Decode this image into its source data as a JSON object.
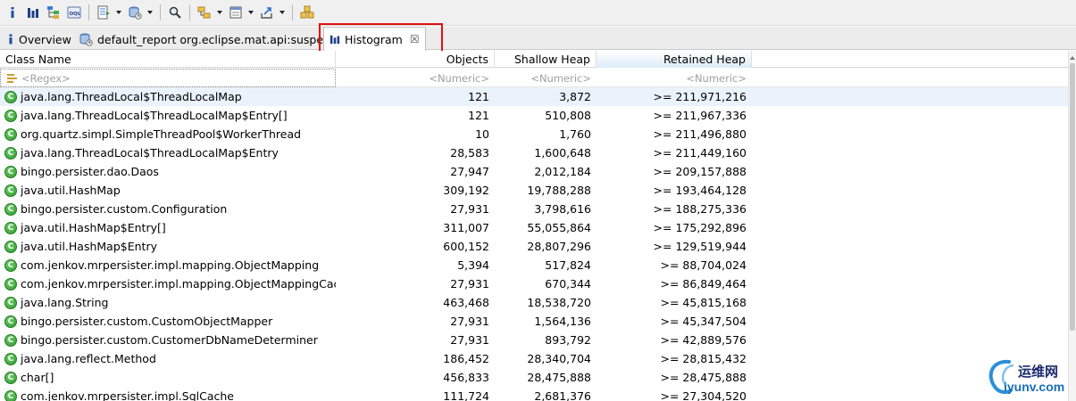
{
  "toolbar": {
    "buttons": [
      "info-icon",
      "histogram-icon",
      "dominator-tree-icon",
      "oql-icon",
      "query-browser-icon",
      "heap-dump-overview-icon",
      "search-icon",
      "group-by-icon",
      "calculate-retained-size-icon",
      "export-icon",
      "find-object-icon"
    ]
  },
  "tabs": {
    "overview": "Overview",
    "report": "default_report  org.eclipse.mat.api:suspects",
    "histogram": "Histogram",
    "close_glyph": "☒"
  },
  "table": {
    "headers": {
      "class_name": "Class Name",
      "objects": "Objects",
      "shallow_heap": "Shallow Heap",
      "retained_heap": "Retained Heap"
    },
    "filters": {
      "class_name": "<Regex>",
      "objects": "<Numeric>",
      "shallow_heap": "<Numeric>",
      "retained_heap": "<Numeric>"
    },
    "rows": [
      {
        "class_name": "java.lang.ThreadLocal$ThreadLocalMap",
        "objects": "121",
        "shallow": "3,872",
        "retained": ">= 211,971,216"
      },
      {
        "class_name": "java.lang.ThreadLocal$ThreadLocalMap$Entry[]",
        "objects": "121",
        "shallow": "510,808",
        "retained": ">= 211,967,336"
      },
      {
        "class_name": "org.quartz.simpl.SimpleThreadPool$WorkerThread",
        "objects": "10",
        "shallow": "1,760",
        "retained": ">= 211,496,880"
      },
      {
        "class_name": "java.lang.ThreadLocal$ThreadLocalMap$Entry",
        "objects": "28,583",
        "shallow": "1,600,648",
        "retained": ">= 211,449,160"
      },
      {
        "class_name": "bingo.persister.dao.Daos",
        "objects": "27,947",
        "shallow": "2,012,184",
        "retained": ">= 209,157,888"
      },
      {
        "class_name": "java.util.HashMap",
        "objects": "309,192",
        "shallow": "19,788,288",
        "retained": ">= 193,464,128"
      },
      {
        "class_name": "bingo.persister.custom.Configuration",
        "objects": "27,931",
        "shallow": "3,798,616",
        "retained": ">= 188,275,336"
      },
      {
        "class_name": "java.util.HashMap$Entry[]",
        "objects": "311,007",
        "shallow": "55,055,864",
        "retained": ">= 175,292,896"
      },
      {
        "class_name": "java.util.HashMap$Entry",
        "objects": "600,152",
        "shallow": "28,807,296",
        "retained": ">= 129,519,944"
      },
      {
        "class_name": "com.jenkov.mrpersister.impl.mapping.ObjectMapping",
        "objects": "5,394",
        "shallow": "517,824",
        "retained": ">= 88,704,024"
      },
      {
        "class_name": "com.jenkov.mrpersister.impl.mapping.ObjectMappingCache",
        "objects": "27,931",
        "shallow": "670,344",
        "retained": ">= 86,849,464"
      },
      {
        "class_name": "java.lang.String",
        "objects": "463,468",
        "shallow": "18,538,720",
        "retained": ">= 45,815,168"
      },
      {
        "class_name": "bingo.persister.custom.CustomObjectMapper",
        "objects": "27,931",
        "shallow": "1,564,136",
        "retained": ">= 45,347,504"
      },
      {
        "class_name": "bingo.persister.custom.CustomerDbNameDeterminer",
        "objects": "27,931",
        "shallow": "893,792",
        "retained": ">= 42,889,576"
      },
      {
        "class_name": "java.lang.reflect.Method",
        "objects": "186,452",
        "shallow": "28,340,704",
        "retained": ">= 28,815,432"
      },
      {
        "class_name": "char[]",
        "objects": "456,833",
        "shallow": "28,475,888",
        "retained": ">= 28,475,888"
      },
      {
        "class_name": "com.jenkov.mrpersister.impl.SqlCache",
        "objects": "111,724",
        "shallow": "2,681,376",
        "retained": ">= 27,304,520"
      }
    ]
  },
  "watermark": {
    "cn": "运维网",
    "en": "iyunv.com"
  },
  "colors": {
    "highlight": "#e01010",
    "class_icon": "#2e9a2e",
    "sorted_header": "#dcecf9"
  }
}
